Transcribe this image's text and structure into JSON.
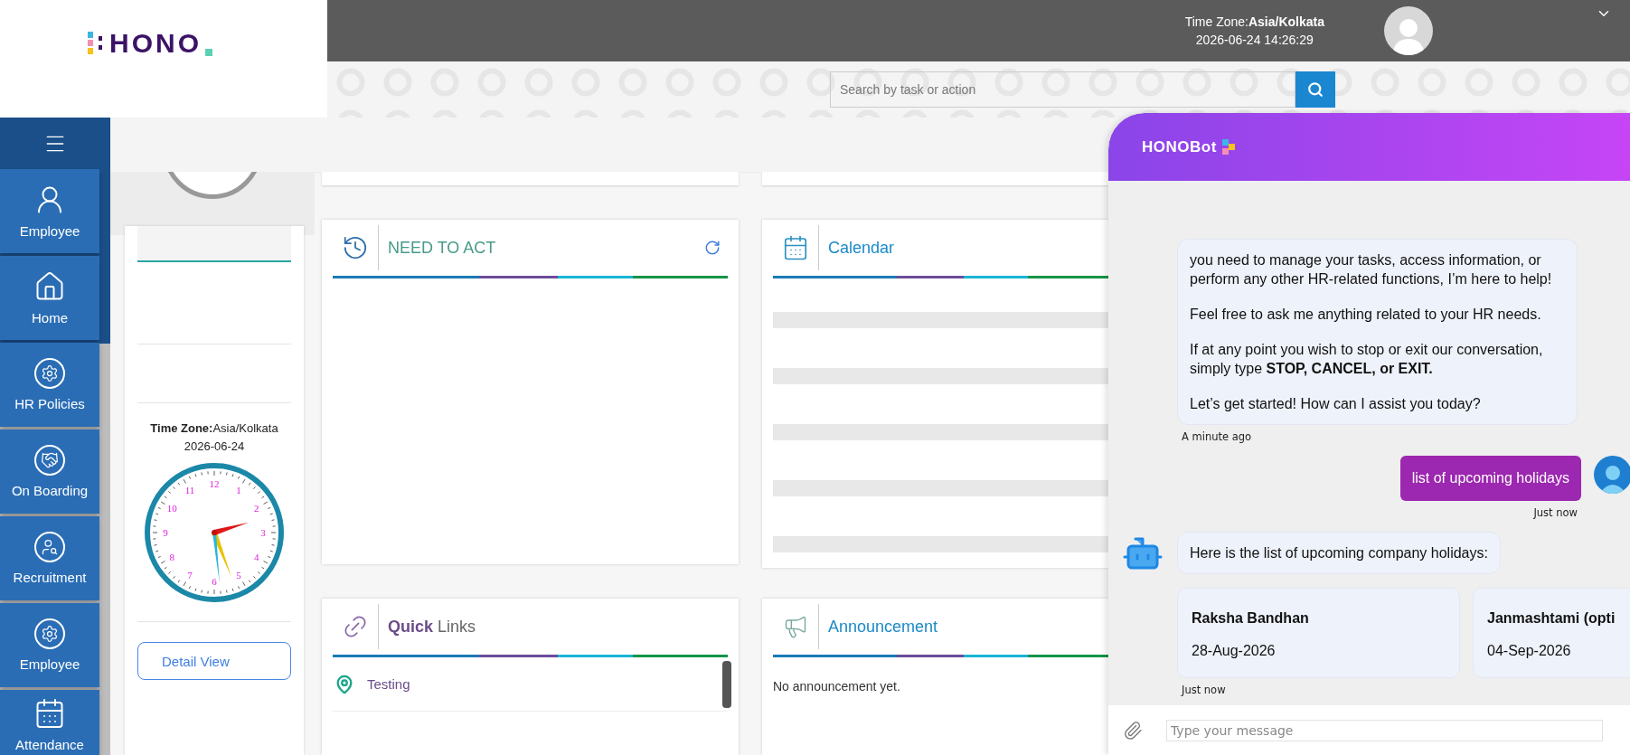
{
  "header": {
    "logo": "HONO",
    "timezone": "Time Zone:**Asia/Kolkata**",
    "datetime": "2026-06-24 14:26:29",
    "search": {
      "placeholder": "Search by task or action"
    }
  },
  "sidebar": {
    "items": [
      {
        "label": "Employee",
        "kind": "person"
      },
      {
        "label": "Home",
        "kind": "home"
      },
      {
        "label": "HR Policies",
        "kind": "gear"
      },
      {
        "label": "On Boarding",
        "kind": "handshake"
      },
      {
        "label": "Recruitment",
        "kind": "search_person"
      },
      {
        "label": "Employee",
        "kind": "gear"
      },
      {
        "label": "Attendance",
        "kind": "calendar"
      }
    ]
  },
  "profile": {
    "timezone": "**Time Zone:**Asia/Kolkata",
    "date": "2026-06-24",
    "clock": {
      "numerals": [
        "12",
        "1",
        "2",
        "3",
        "4",
        "5",
        "6",
        "7",
        "8",
        "9",
        "10",
        "11"
      ]
    },
    "button": "Detail View"
  },
  "widgets": [
    {
      "kind": "need_to_act",
      "title": "NEED TO ACT",
      "refresh": true
    },
    {
      "kind": "calendar",
      "title": "Calendar",
      "loading": true
    },
    {
      "kind": "quick_links",
      "title": "**Quick** Links",
      "links": [
        "Testing"
      ]
    },
    {
      "kind": "announcement",
      "title": "Announcement",
      "message": "No announcement yet."
    }
  ],
  "chat": {
    "title": "HONOBot",
    "messages": [
      {
        "kind": "bot_text",
        "paragraphs": [
          "you need to manage your tasks, access information, or perform any other HR-related functions, I’m here to help!",
          "Feel free to ask me anything related to your HR needs.",
          "If at any point you wish to stop or exit our conversation, simply type **STOP, CANCEL, or EXIT.**",
          "Let’s get started! How can I assist you today?"
        ],
        "time": "A minute ago"
      },
      {
        "kind": "user",
        "text": "list of upcoming holidays",
        "time": "Just now"
      },
      {
        "kind": "bot_cards",
        "text": "Here is the list of upcoming company holidays:",
        "cards": [
          {
            "name": "Raksha Bandhan",
            "date": "28-Aug-2026"
          },
          {
            "name": "Janmashtami (opti",
            "date": "04-Sep-2026"
          }
        ],
        "time": "Just now"
      }
    ],
    "input": {
      "placeholder": "Type your message"
    }
  }
}
